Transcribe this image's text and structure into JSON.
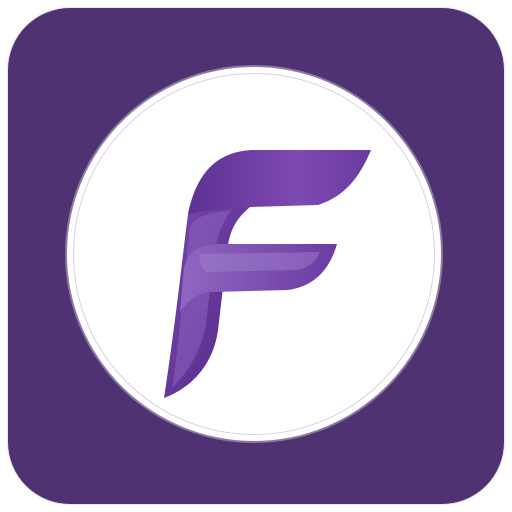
{
  "app_icon": {
    "logo_letter": "F",
    "colors": {
      "background": "#4f3272",
      "disc": "#ffffff",
      "logo_dark": "#5a2f8e",
      "logo_mid": "#7c4cb0",
      "logo_light": "#9a73c6"
    },
    "icon_name": "letter-f-logo-icon"
  }
}
